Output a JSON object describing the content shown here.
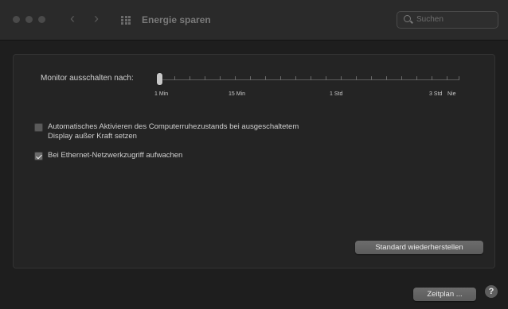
{
  "window": {
    "title": "Energie sparen",
    "search_placeholder": "Suchen"
  },
  "monitor": {
    "label": "Monitor ausschalten nach:",
    "ticks": [
      "1 Min",
      "15 Min",
      "1 Std",
      "3 Std",
      "Nie"
    ],
    "value": "1 Min"
  },
  "options": [
    {
      "label_line1": "Automatisches Aktivieren des Computerruhezustands bei ausgeschaltetem",
      "label_line2": "Display außer Kraft setzen",
      "checked": false
    },
    {
      "label_line1": "Bei Ethernet-Netzwerkzugriff aufwachen",
      "checked": true
    }
  ],
  "buttons": {
    "restore_defaults": "Standard wiederherstellen",
    "schedule": "Zeitplan ...",
    "help": "?"
  }
}
